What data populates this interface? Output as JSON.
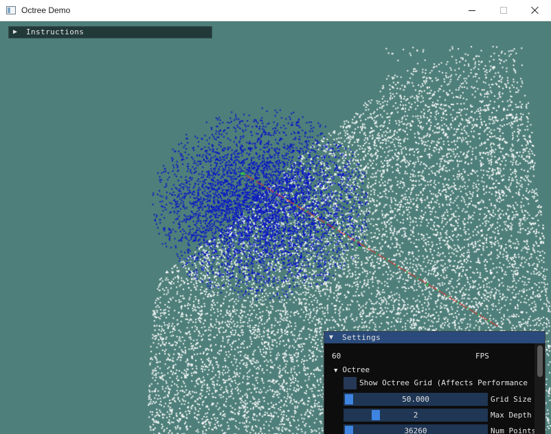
{
  "window": {
    "title": "Octree Demo"
  },
  "colors": {
    "background": "#4f7f7a",
    "white_points": "#ffffff",
    "blue_points": "#0a14c8",
    "green_points": "#2fbf3a",
    "red_line": "#d8322d",
    "panel_header": "#294a7a",
    "slider_grab": "#3d85e0"
  },
  "instructions": {
    "arrow": "▶",
    "label": "Instructions"
  },
  "settings": {
    "arrow": "▼",
    "title": "Settings",
    "fps_value": "60",
    "fps_label": "FPS",
    "octree_arrow": "▼",
    "octree_label": "Octree",
    "show_grid_label": "Show Octree Grid (Affects Performance",
    "grid_size": {
      "value": "50.000",
      "label": "Grid Size",
      "fraction": 0.0
    },
    "max_depth": {
      "value": "2",
      "label": "Max Depth",
      "fraction": 0.2
    },
    "num_points": {
      "value": "36260",
      "label": "Num Points",
      "fraction": 0.0
    }
  }
}
